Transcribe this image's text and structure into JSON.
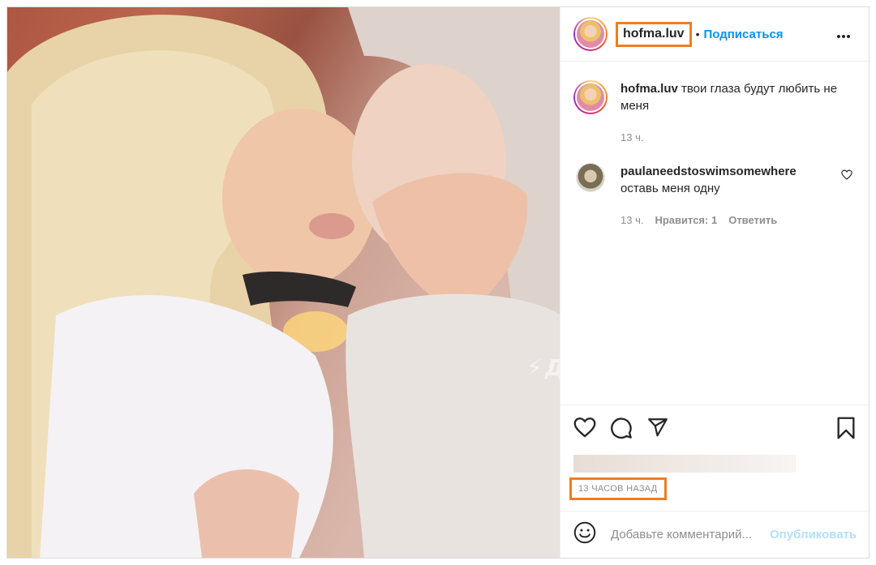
{
  "post": {
    "author": {
      "username": "hofma.luv",
      "follow_label": "Подписаться",
      "separator": "•",
      "more_label": "•••"
    },
    "media": {
      "watermark": "Двач",
      "watermark_icon": "lightning-bolt-icon"
    },
    "caption": {
      "username": "hofma.luv",
      "text": "твои глаза будут любить не меня",
      "time": "13 ч."
    },
    "comments": [
      {
        "username": "paulaneedstoswimsomewhere",
        "text": "оставь меня одну",
        "time": "13 ч.",
        "likes_label": "Нравится: 1",
        "reply_label": "Ответить"
      }
    ],
    "actions": {
      "icons": [
        "heart-icon",
        "comment-icon",
        "share-icon",
        "bookmark-icon"
      ]
    },
    "timestamp": "13 ЧАСОВ НАЗАД",
    "add_comment": {
      "placeholder": "Добавьте комментарий...",
      "publish_label": "Опубликовать"
    }
  },
  "colors": {
    "accent_link": "#0095f6",
    "publish_disabled": "#b2dffc",
    "highlight_box": "#ef7d22",
    "muted_text": "#8e8e8e"
  }
}
